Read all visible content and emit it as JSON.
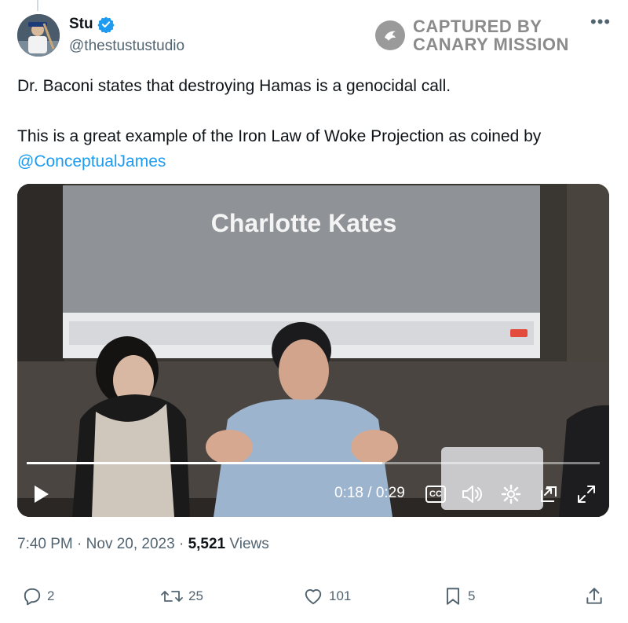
{
  "author": {
    "name": "Stu",
    "handle": "@thestustustudio",
    "verified": true
  },
  "watermark": {
    "line1": "CAPTURED BY",
    "line2": "CANARY MISSION"
  },
  "more_label": "•••",
  "tweet": {
    "line1": "Dr. Baconi states that destroying Hamas is a genocidal call.",
    "line2": "This is a great example of the Iron Law of Woke Projection as coined by",
    "mention": "@ConceptualJames"
  },
  "video": {
    "screen_title": "Charlotte Kates",
    "current_time": "0:18",
    "duration": "0:29",
    "time_display": "0:18 / 0:29",
    "progress": 0.62,
    "cc_label": "CC"
  },
  "meta": {
    "time": "7:40 PM",
    "date": "Nov 20, 2023",
    "views_count": "5,521",
    "views_label": "Views",
    "sep": "·"
  },
  "actions": {
    "replies": "2",
    "reposts": "25",
    "likes": "101",
    "bookmarks": "5"
  },
  "colors": {
    "accent": "#1d9bf0",
    "text": "#0f1419",
    "muted": "#536471"
  }
}
